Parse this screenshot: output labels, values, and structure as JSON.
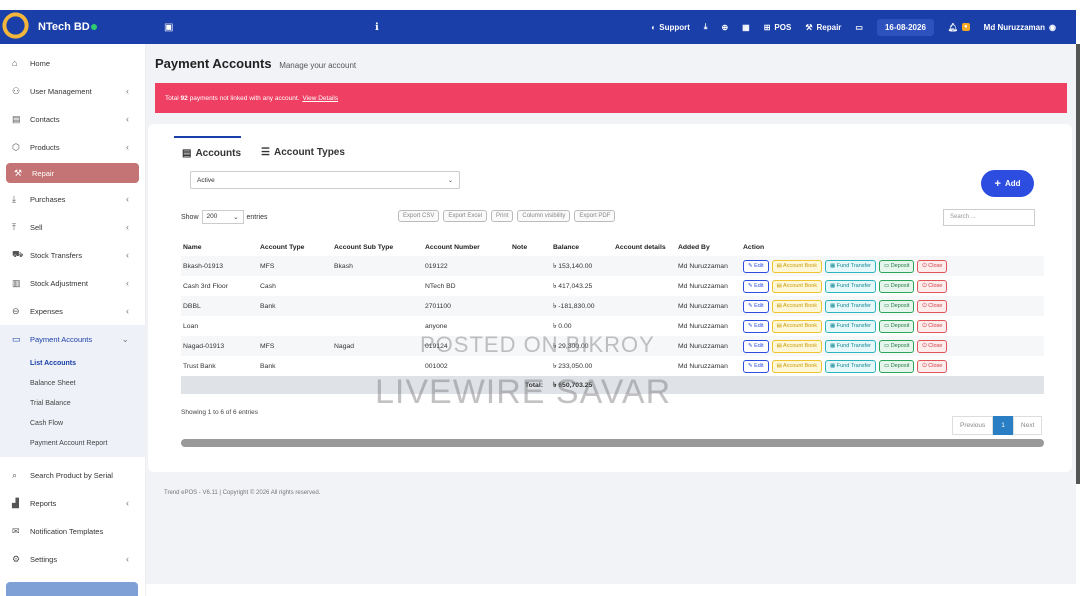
{
  "topbar": {
    "brand": "NTech BD",
    "support": "Support",
    "pos": "POS",
    "repair": "Repair",
    "date": "16-08-2026",
    "user": "Md Nuruzzaman"
  },
  "sidebar": {
    "items": [
      {
        "label": "Home",
        "icon": "home-icon"
      },
      {
        "label": "User Management",
        "icon": "users-icon"
      },
      {
        "label": "Contacts",
        "icon": "contacts-icon"
      },
      {
        "label": "Products",
        "icon": "box-icon"
      },
      {
        "label": "Repair",
        "icon": "wrench-icon"
      },
      {
        "label": "Purchases",
        "icon": "download-icon"
      },
      {
        "label": "Sell",
        "icon": "upload-icon"
      },
      {
        "label": "Stock Transfers",
        "icon": "truck-icon"
      },
      {
        "label": "Stock Adjustment",
        "icon": "database-icon"
      },
      {
        "label": "Expenses",
        "icon": "minus-circle-icon"
      },
      {
        "label": "Payment Accounts",
        "icon": "money-icon"
      }
    ],
    "payment_sub": [
      "List Accounts",
      "Balance Sheet",
      "Trial Balance",
      "Cash Flow",
      "Payment Account Report"
    ],
    "bottom_items": [
      {
        "label": "Search Product by Serial",
        "icon": "search-icon"
      },
      {
        "label": "Reports",
        "icon": "chart-icon"
      },
      {
        "label": "Notification Templates",
        "icon": "envelope-icon"
      },
      {
        "label": "Settings",
        "icon": "gear-icon"
      }
    ]
  },
  "page": {
    "title": "Payment Accounts",
    "subtitle": "Manage your account",
    "alert_pre": "Total",
    "alert_count": "92",
    "alert_text": "payments not linked with any account.",
    "alert_link": "View Details"
  },
  "tabs": [
    "Accounts",
    "Account Types"
  ],
  "filter": {
    "status": "Active"
  },
  "add_label": "Add",
  "length": {
    "show": "Show",
    "value": "200",
    "entries": "entries"
  },
  "exports": [
    "Export CSV",
    "Export Excel",
    "Print",
    "Column visibility",
    "Export PDF"
  ],
  "search_placeholder": "Search ...",
  "table": {
    "headers": [
      "Name",
      "Account Type",
      "Account Sub Type",
      "Account Number",
      "Note",
      "Balance",
      "Account details",
      "Added By",
      "Action"
    ],
    "rows": [
      {
        "name": "Bkash-01913",
        "type": "MFS",
        "subtype": "Bkash",
        "number": "019122",
        "note": "",
        "balance": "৳ 153,140.00",
        "details": "",
        "added_by": "Md Nuruzzaman"
      },
      {
        "name": "Cash 3rd Floor",
        "type": "Cash",
        "subtype": "",
        "number": "NTech BD",
        "note": "",
        "balance": "৳ 417,043.25",
        "details": "",
        "added_by": "Md Nuruzzaman"
      },
      {
        "name": "DBBL",
        "type": "Bank",
        "subtype": "",
        "number": "2701100",
        "note": "",
        "balance": "৳ -181,830.00",
        "details": "",
        "added_by": "Md Nuruzzaman"
      },
      {
        "name": "Loan",
        "type": "",
        "subtype": "",
        "number": "anyone",
        "note": "",
        "balance": "৳ 0.00",
        "details": "",
        "added_by": "Md Nuruzzaman"
      },
      {
        "name": "Nagad-01913",
        "type": "MFS",
        "subtype": "Nagad",
        "number": "019124",
        "note": "",
        "balance": "৳ 29,300.00",
        "details": "",
        "added_by": "Md Nuruzzaman"
      },
      {
        "name": "Trust Bank",
        "type": "Bank",
        "subtype": "",
        "number": "001002",
        "note": "",
        "balance": "৳ 233,050.00",
        "details": "",
        "added_by": "Md Nuruzzaman"
      }
    ],
    "actions": [
      "Edit",
      "Account Book",
      "Fund Transfer",
      "Deposit",
      "Close"
    ],
    "total_label": "Total:",
    "total_value": "৳ 650,703.25"
  },
  "info": "Showing 1 to 6 of 6 entries",
  "pager": {
    "prev": "Previous",
    "page": "1",
    "next": "Next"
  },
  "footer": "Trend ePOS - V6.11 | Copyright © 2026 All rights reserved.",
  "watermark": {
    "line1": "POSTED ON BIKROY",
    "line2": "LIVEWIRE SAVAR"
  },
  "colors": {
    "topbar": "#1a3fa8",
    "alert": "#ef3f62",
    "repair_active": "#c47474",
    "add_button": "#2d4de0"
  }
}
